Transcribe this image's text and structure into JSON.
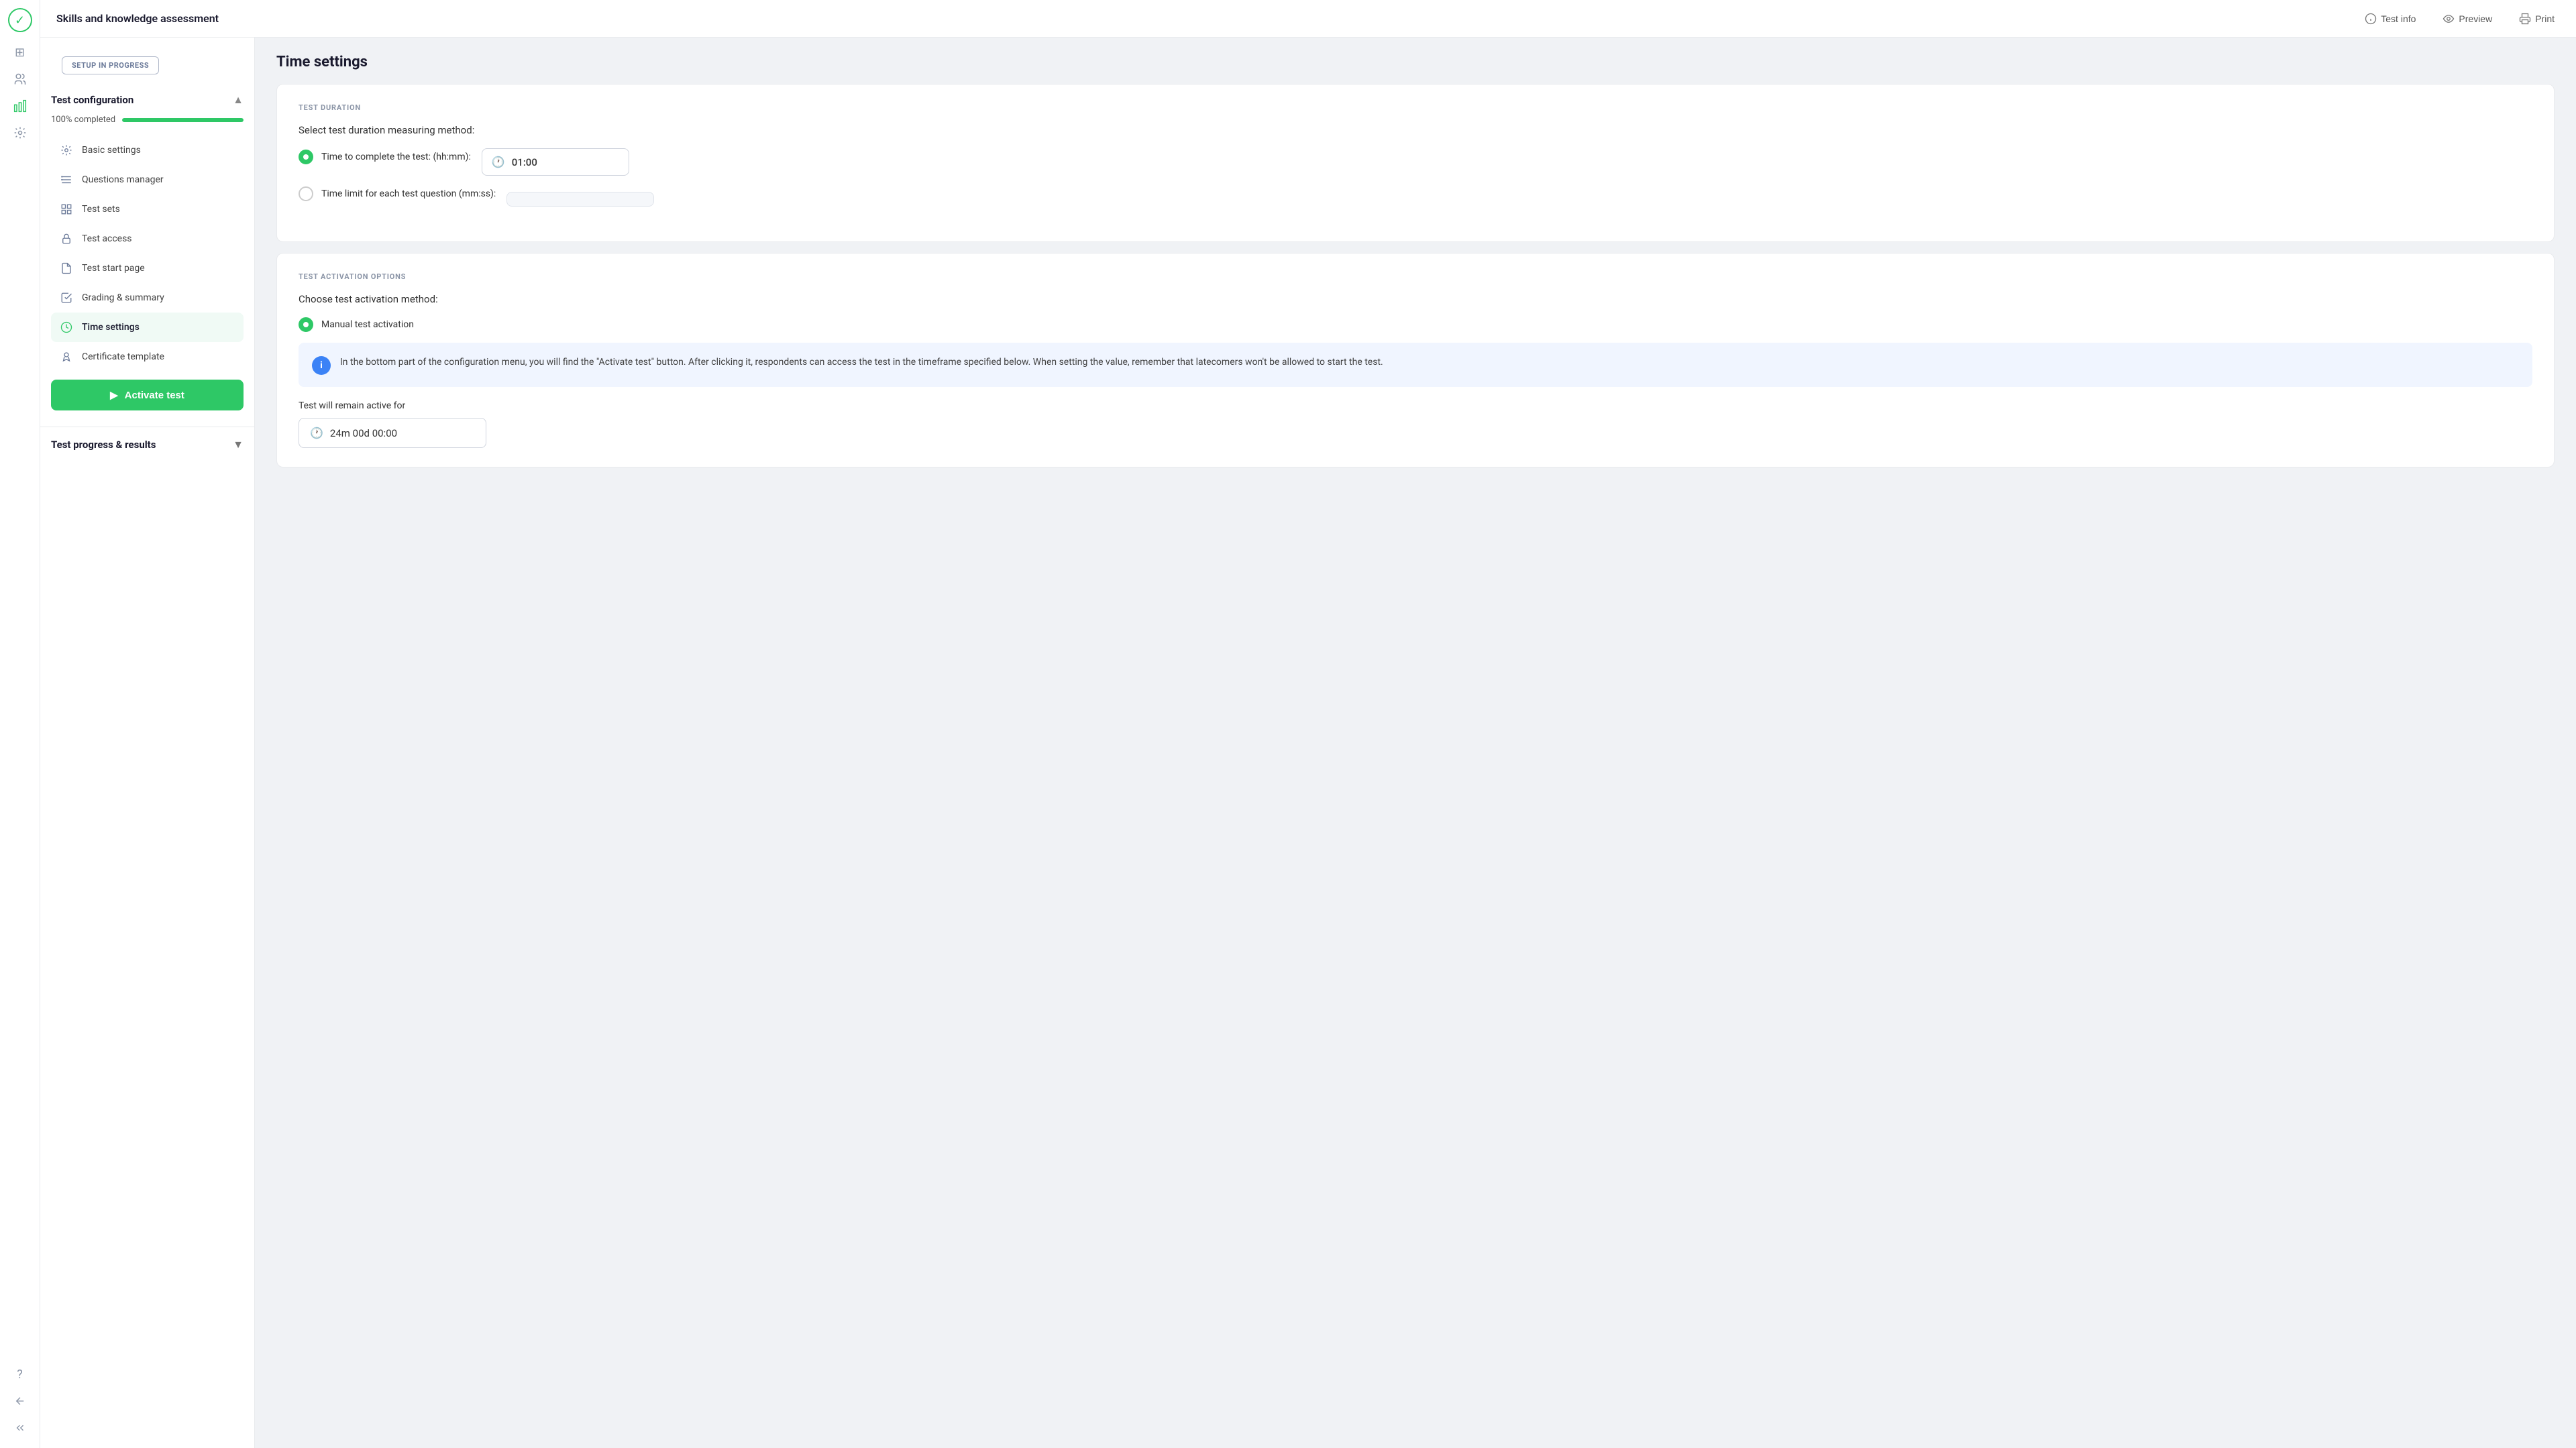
{
  "app": {
    "logo_symbol": "✓",
    "title": "Skills and knowledge assessment"
  },
  "header": {
    "title": "Skills and knowledge assessment",
    "actions": [
      {
        "id": "test-info",
        "icon": "ℹ",
        "label": "Test info"
      },
      {
        "id": "preview",
        "icon": "👁",
        "label": "Preview"
      },
      {
        "id": "print",
        "icon": "🖨",
        "label": "Print"
      }
    ]
  },
  "icon_bar": {
    "nav_icons": [
      {
        "id": "grid",
        "symbol": "⊞",
        "active": false
      },
      {
        "id": "users",
        "symbol": "👥",
        "active": false
      },
      {
        "id": "chart",
        "symbol": "📊",
        "active": false
      },
      {
        "id": "settings",
        "symbol": "⚙",
        "active": false
      }
    ],
    "bottom_icons": [
      {
        "id": "question",
        "symbol": "❓",
        "active": false
      },
      {
        "id": "back",
        "symbol": "⟵",
        "active": false
      },
      {
        "id": "expand",
        "symbol": "≫",
        "active": false
      }
    ]
  },
  "sidebar": {
    "setup_badge": "SETUP IN PROGRESS",
    "config_section": {
      "title": "Test configuration",
      "progress_label": "100% completed",
      "progress_value": 100,
      "items": [
        {
          "id": "basic-settings",
          "icon": "⚙",
          "label": "Basic settings",
          "active": false
        },
        {
          "id": "questions-manager",
          "icon": "≡",
          "label": "Questions manager",
          "active": false
        },
        {
          "id": "test-sets",
          "icon": "⊞",
          "label": "Test sets",
          "active": false
        },
        {
          "id": "test-access",
          "icon": "🔒",
          "label": "Test access",
          "active": false
        },
        {
          "id": "test-start-page",
          "icon": "📄",
          "label": "Test start page",
          "active": false
        },
        {
          "id": "grading-summary",
          "icon": "📋",
          "label": "Grading & summary",
          "active": false
        },
        {
          "id": "time-settings",
          "icon": "🕐",
          "label": "Time settings",
          "active": true
        },
        {
          "id": "certificate-template",
          "icon": "🏆",
          "label": "Certificate template",
          "active": false
        }
      ]
    },
    "activate_btn": "Activate test",
    "results_section": {
      "title": "Test progress & results"
    }
  },
  "main": {
    "page_title": "Time settings",
    "sections": [
      {
        "id": "test-duration",
        "label": "TEST DURATION",
        "question": "Select test duration measuring method:",
        "options": [
          {
            "id": "complete-time",
            "checked": true,
            "label": "Time to complete the test: (hh:mm):",
            "has_input": true,
            "input_value": "01:00"
          },
          {
            "id": "question-limit",
            "checked": false,
            "label": "Time limit for each test question (mm:ss):",
            "has_input": true,
            "input_value": "",
            "disabled": true
          }
        ]
      },
      {
        "id": "activation-options",
        "label": "TEST ACTIVATION OPTIONS",
        "question": "Choose test activation method:",
        "options": [
          {
            "id": "manual",
            "checked": true,
            "label": "Manual test activation",
            "has_input": false
          }
        ],
        "info_box": {
          "text": "In the bottom part of the configuration menu, you will find the \"Activate test\" button. After clicking it, respondents can access the test in the timeframe specified below. When setting the value, remember that latecomers won't be allowed to start the test."
        },
        "active_for_label": "Test will remain active for",
        "active_for_value": "24m 00d 00:00"
      }
    ]
  }
}
